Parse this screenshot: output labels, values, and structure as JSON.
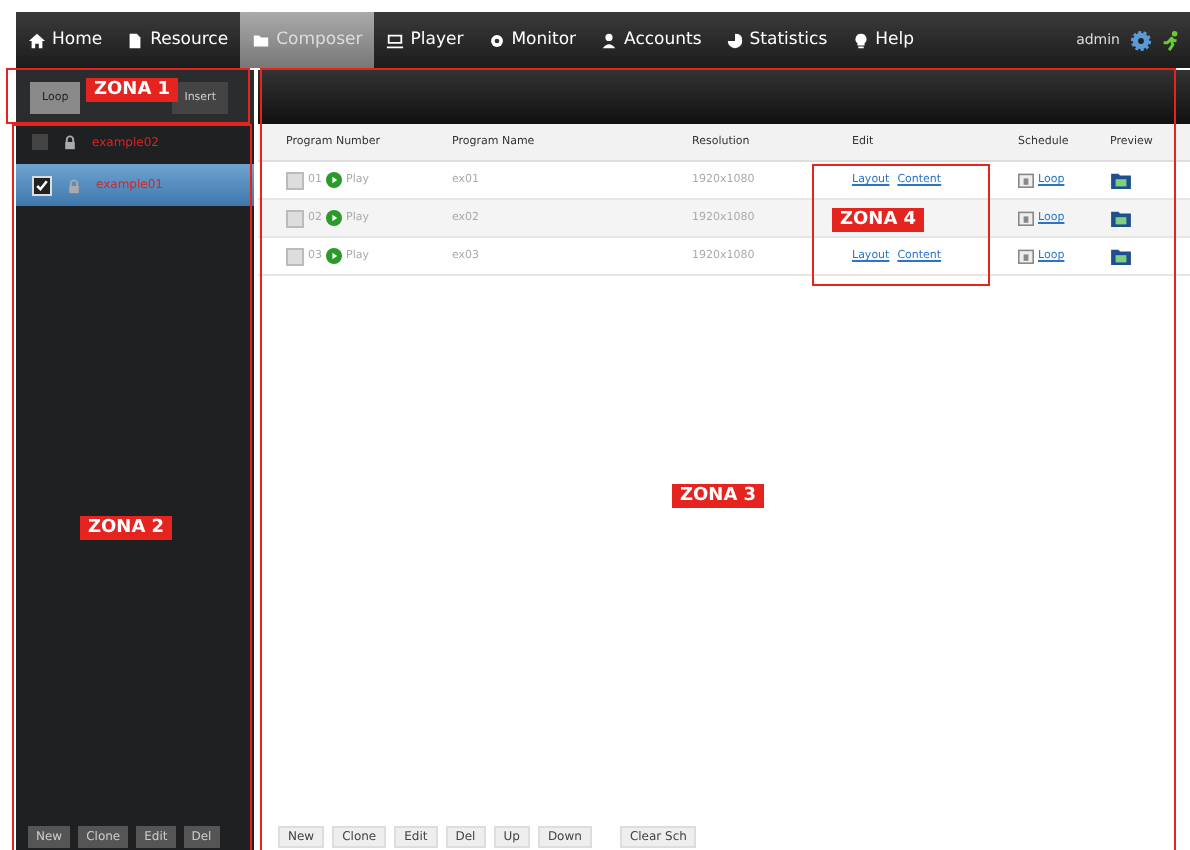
{
  "nav": {
    "items": [
      {
        "label": "Home",
        "selected": false
      },
      {
        "label": "Resource",
        "selected": false
      },
      {
        "label": "Composer",
        "selected": true
      },
      {
        "label": "Player",
        "selected": false
      },
      {
        "label": "Monitor",
        "selected": false
      },
      {
        "label": "Accounts",
        "selected": false
      },
      {
        "label": "Statistics",
        "selected": false
      },
      {
        "label": "Help",
        "selected": false
      }
    ],
    "user": "admin"
  },
  "sidebar": {
    "tabs": [
      {
        "label": "Loop",
        "selected": true
      },
      {
        "label": "Insert",
        "selected": false
      }
    ],
    "items": [
      {
        "name": "example02",
        "checked": false,
        "selected": false
      },
      {
        "name": "example01",
        "checked": true,
        "selected": true
      }
    ],
    "buttons": [
      "New",
      "Clone",
      "Edit",
      "Del"
    ]
  },
  "table": {
    "columns": [
      "Program Number",
      "Program Name",
      "Resolution",
      "Edit",
      "Schedule",
      "Preview"
    ],
    "rows": [
      {
        "checked": false,
        "number": "01",
        "play": "Play",
        "name": "ex01",
        "resolution": "1920x1080",
        "edit": [
          "Layout",
          "Content"
        ],
        "schedule": "Loop"
      },
      {
        "checked": false,
        "number": "02",
        "play": "Play",
        "name": "ex02",
        "resolution": "1920x1080",
        "schedule": "Loop"
      },
      {
        "checked": false,
        "number": "03",
        "play": "Play",
        "name": "ex03",
        "resolution": "1920x1080",
        "edit": [
          "Layout",
          "Content"
        ],
        "schedule": "Loop"
      }
    ],
    "buttons": [
      "New",
      "Clone",
      "Edit",
      "Del",
      "Up",
      "Down",
      "Clear Sch"
    ]
  },
  "annotations": [
    {
      "label": "ZONA 1"
    },
    {
      "label": "ZONA 2"
    },
    {
      "label": "ZONA 3"
    },
    {
      "label": "ZONA 4"
    }
  ]
}
